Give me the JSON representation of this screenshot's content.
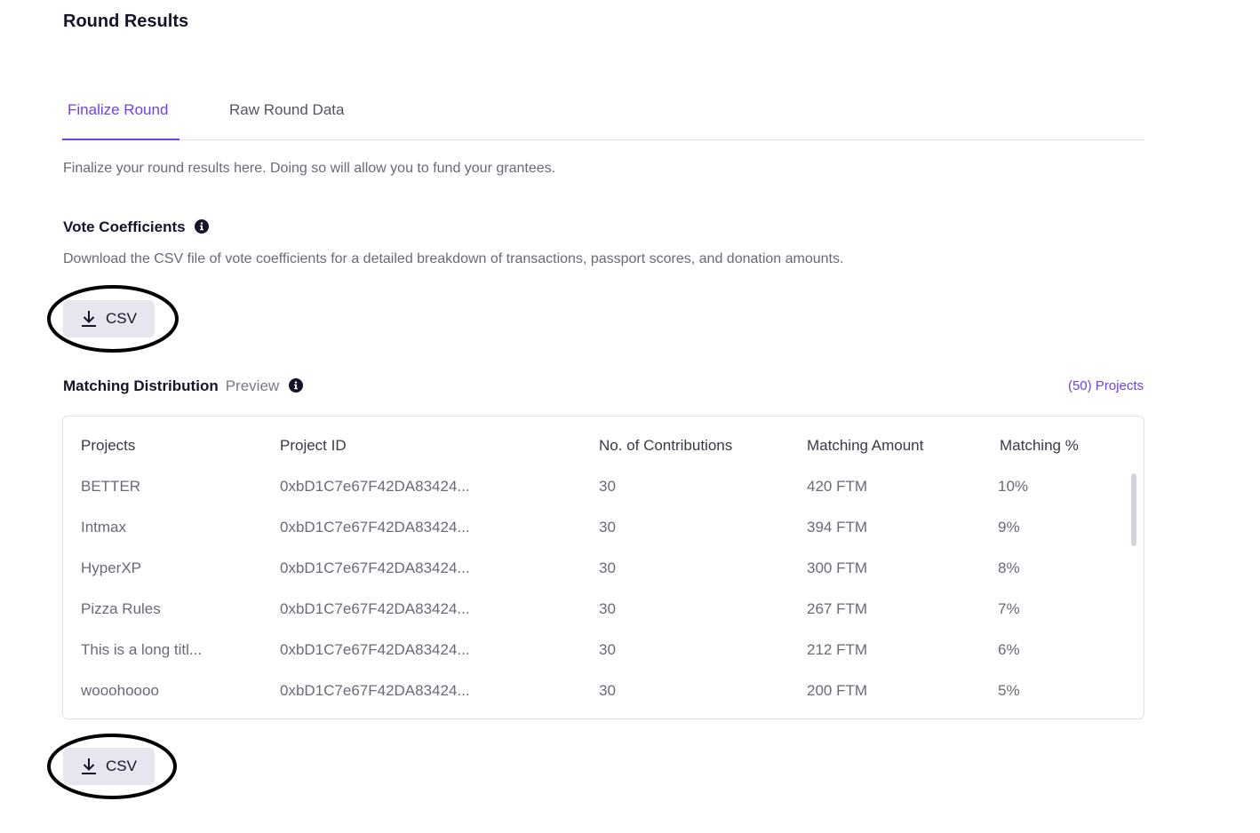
{
  "header": {
    "title": "Round Results"
  },
  "tabs": [
    {
      "label": "Finalize Round",
      "active": true
    },
    {
      "label": "Raw Round Data",
      "active": false
    }
  ],
  "intro_text": "Finalize your round results here. Doing so will allow you to fund your grantees.",
  "vote_coefficients": {
    "title": "Vote Coefficients",
    "info_icon": "info-icon",
    "description": "Download the CSV file of vote coefficients for a detailed breakdown of transactions, passport scores, and donation amounts.",
    "button_label": "CSV",
    "button_icon": "download-icon"
  },
  "matching_distribution": {
    "title": "Matching Distribution",
    "preview_label": "Preview",
    "info_icon": "info-icon",
    "project_count": "(50) Projects",
    "columns": [
      "Projects",
      "Project ID",
      "No. of Contributions",
      "Matching Amount",
      "Matching %"
    ],
    "rows": [
      {
        "project": "BETTER",
        "project_id": "0xbD1C7e67F42DA83424...",
        "contributions": "30",
        "amount": "420 FTM",
        "percent": "10%"
      },
      {
        "project": "Intmax",
        "project_id": "0xbD1C7e67F42DA83424...",
        "contributions": "30",
        "amount": "394 FTM",
        "percent": "9%"
      },
      {
        "project": "HyperXP",
        "project_id": "0xbD1C7e67F42DA83424...",
        "contributions": "30",
        "amount": "300 FTM",
        "percent": "8%"
      },
      {
        "project": "Pizza Rules",
        "project_id": "0xbD1C7e67F42DA83424...",
        "contributions": "30",
        "amount": "267 FTM",
        "percent": "7%"
      },
      {
        "project": "This is a long titl...",
        "project_id": "0xbD1C7e67F42DA83424...",
        "contributions": "30",
        "amount": "212 FTM",
        "percent": "6%"
      },
      {
        "project": "wooohoooo",
        "project_id": "0xbD1C7e67F42DA83424...",
        "contributions": "30",
        "amount": "200 FTM",
        "percent": "5%"
      }
    ],
    "button_label": "CSV",
    "button_icon": "download-icon"
  },
  "colors": {
    "accent": "#6f3ff5",
    "button_bg": "#e7e5ee",
    "annotation": "#000000"
  }
}
